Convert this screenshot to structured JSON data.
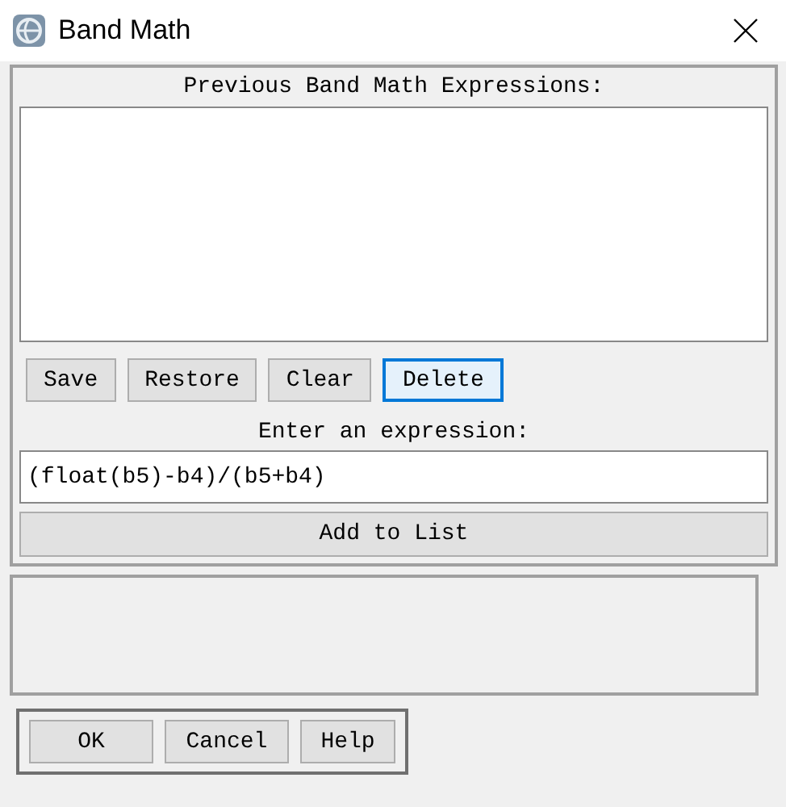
{
  "window": {
    "title": "Band Math"
  },
  "history": {
    "label": "Previous Band Math Expressions:"
  },
  "history_buttons": [
    {
      "label": "Save",
      "focused": false
    },
    {
      "label": "Restore",
      "focused": false
    },
    {
      "label": "Clear",
      "focused": false
    },
    {
      "label": "Delete",
      "focused": true
    }
  ],
  "expression": {
    "label": "Enter an expression:",
    "value": "(float(b5)-b4)/(b5+b4)"
  },
  "add_button": {
    "label": "Add to List"
  },
  "dialog_buttons": [
    "OK",
    "Cancel",
    "Help"
  ]
}
